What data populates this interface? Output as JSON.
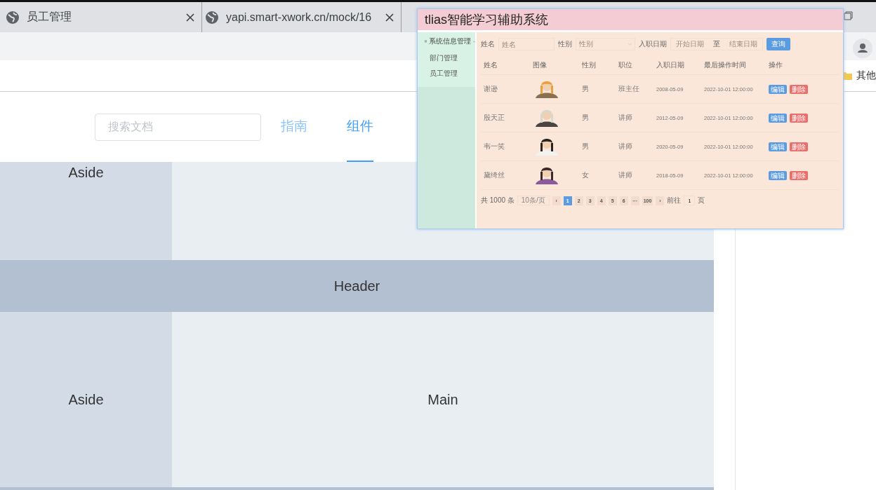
{
  "browser_tabs": [
    {
      "title": "员工管理"
    },
    {
      "title": "yapi.smart-xwork.cn/mock/16"
    }
  ],
  "bookmark": "其他",
  "docs": {
    "search_placeholder": "搜索文档",
    "nav": [
      {
        "label": "指南",
        "selected": false
      },
      {
        "label": "组件",
        "selected": true
      }
    ]
  },
  "layout_demo": [
    {
      "kind": "split",
      "aside": "Aside"
    },
    {
      "kind": "header",
      "label": "Header"
    },
    {
      "kind": "split",
      "aside": "Aside",
      "main": "Main"
    }
  ],
  "app": {
    "title": "tlias智能学习辅助系统",
    "menu": {
      "label": "系统信息管理",
      "expanded": true,
      "children": [
        {
          "label": "部门管理"
        },
        {
          "label": "员工管理"
        }
      ]
    },
    "filters": {
      "name_label": "姓名",
      "name_placeholder": "姓名",
      "gender_label": "性别",
      "gender_placeholder": "性别",
      "date_label": "入职日期",
      "start_placeholder": "开始日期",
      "range_separator": "至",
      "end_placeholder": "结束日期",
      "search_button": "查询"
    },
    "columns": [
      "姓名",
      "图像",
      "性别",
      "职位",
      "入职日期",
      "最后操作时间",
      "操作"
    ],
    "rows": [
      {
        "name": "谢逊",
        "avatar": {
          "kind": "picture"
        },
        "gender": "男",
        "position": "班主任",
        "entry_date": "2008-05-09",
        "updated": "2022-10-01 12:00:00",
        "actions": [
          "编辑",
          "删除"
        ]
      },
      {
        "name": "殷天正",
        "avatar": {
          "kind": "picture"
        },
        "gender": "男",
        "position": "讲师",
        "entry_date": "2012-05-09",
        "updated": "2022-10-01 12:00:00",
        "actions": [
          "编辑",
          "删除"
        ]
      },
      {
        "name": "韦一笑",
        "avatar": {
          "kind": "picture"
        },
        "gender": "男",
        "position": "讲师",
        "entry_date": "2020-05-09",
        "updated": "2022-10-01 12:00:00",
        "actions": [
          "编辑",
          "删除"
        ]
      },
      {
        "name": "黛绮丝",
        "avatar": {
          "kind": "picture"
        },
        "gender": "女",
        "position": "讲师",
        "entry_date": "2018-05-09",
        "updated": "2022-10-01 12:00:00",
        "actions": [
          "编辑",
          "删除"
        ]
      }
    ],
    "pagination": {
      "total": "共 1000 条",
      "page_size": "10条/页",
      "prev": "‹",
      "pages": [
        {
          "label": "1",
          "selected": true
        },
        {
          "label": "2",
          "selected": false
        },
        {
          "label": "3",
          "selected": false
        },
        {
          "label": "4",
          "selected": false
        },
        {
          "label": "5",
          "selected": false
        },
        {
          "label": "6",
          "selected": false
        },
        {
          "label": "···",
          "selected": false
        },
        {
          "label": "100",
          "selected": false
        }
      ],
      "next": "›",
      "goto_label": "前往",
      "goto_value": "1",
      "goto_unit": "页"
    }
  }
}
